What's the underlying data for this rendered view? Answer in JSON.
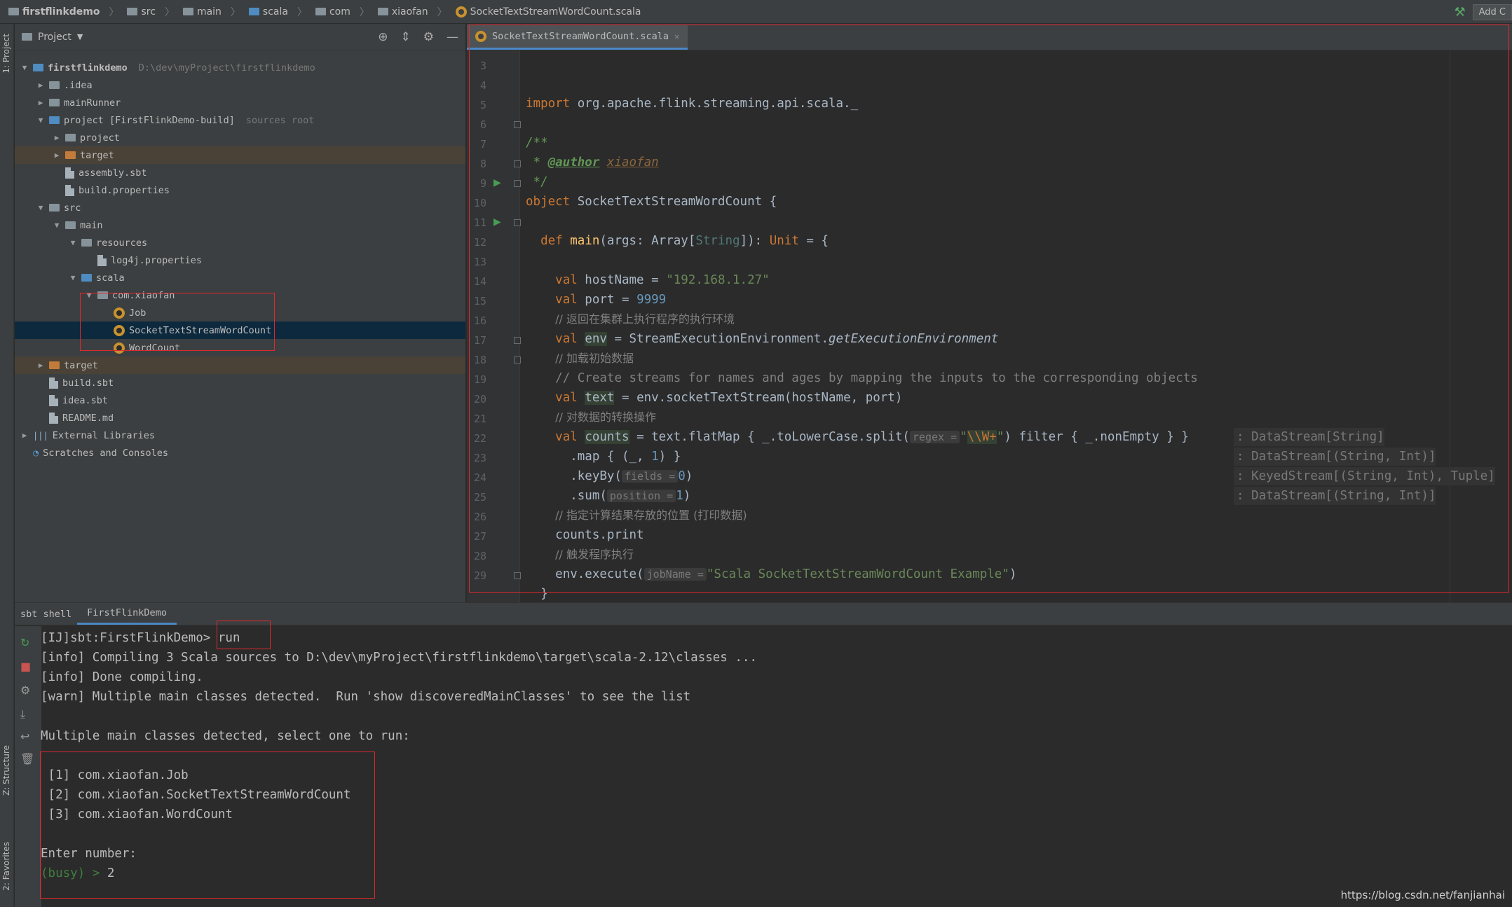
{
  "breadcrumb": [
    "firstflinkdemo",
    "src",
    "main",
    "scala",
    "com",
    "xiaofan",
    "SocketTextStreamWordCount.scala"
  ],
  "nav": {
    "add_label": "Add C"
  },
  "left_stripe": {
    "project_tab": "1: Project",
    "structure_tab": "Z: Structure",
    "favorites_tab": "2: Favorites"
  },
  "project": {
    "header": "Project",
    "tree": [
      {
        "label": "firstflinkdemo",
        "hint": "D:\\dev\\myProject\\firstflinkdemo",
        "arrow": "▼",
        "icon": "module-folder-icon"
      },
      {
        "label": ".idea",
        "hint": "",
        "arrow": "▶",
        "icon": "folder-icon"
      },
      {
        "label": "mainRunner",
        "hint": "",
        "arrow": "▶",
        "icon": "folder-icon"
      },
      {
        "label": "project [FirstFlinkDemo-build]",
        "hint": "sources root",
        "arrow": "▼",
        "icon": "module-folder-icon"
      },
      {
        "label": "project",
        "hint": "",
        "arrow": "▶",
        "icon": "folder-icon"
      },
      {
        "label": "target",
        "hint": "",
        "arrow": "▶",
        "icon": "excluded-folder-icon"
      },
      {
        "label": "assembly.sbt",
        "hint": "",
        "arrow": "",
        "icon": "sbt-file-icon"
      },
      {
        "label": "build.properties",
        "hint": "",
        "arrow": "",
        "icon": "properties-file-icon"
      },
      {
        "label": "src",
        "hint": "",
        "arrow": "▼",
        "icon": "folder-icon"
      },
      {
        "label": "main",
        "hint": "",
        "arrow": "▼",
        "icon": "folder-icon"
      },
      {
        "label": "resources",
        "hint": "",
        "arrow": "▼",
        "icon": "resources-folder-icon"
      },
      {
        "label": "log4j.properties",
        "hint": "",
        "arrow": "",
        "icon": "properties-file-icon"
      },
      {
        "label": "scala",
        "hint": "",
        "arrow": "▼",
        "icon": "source-folder-icon"
      },
      {
        "label": "com.xiaofan",
        "hint": "",
        "arrow": "▼",
        "icon": "package-icon"
      },
      {
        "label": "Job",
        "hint": "",
        "arrow": "",
        "icon": "scala-object-icon"
      },
      {
        "label": "SocketTextStreamWordCount",
        "hint": "",
        "arrow": "",
        "icon": "scala-object-icon"
      },
      {
        "label": "WordCount",
        "hint": "",
        "arrow": "",
        "icon": "scala-object-icon"
      },
      {
        "label": "target",
        "hint": "",
        "arrow": "▶",
        "icon": "excluded-folder-icon"
      },
      {
        "label": "build.sbt",
        "hint": "",
        "arrow": "",
        "icon": "sbt-file-icon"
      },
      {
        "label": "idea.sbt",
        "hint": "",
        "arrow": "",
        "icon": "sbt-file-icon"
      },
      {
        "label": "README.md",
        "hint": "",
        "arrow": "",
        "icon": "markdown-file-icon"
      },
      {
        "label": "External Libraries",
        "hint": "",
        "arrow": "▶",
        "icon": "libraries-icon"
      },
      {
        "label": "Scratches and Consoles",
        "hint": "",
        "arrow": "",
        "icon": "scratches-icon"
      }
    ]
  },
  "editor": {
    "tab": "SocketTextStreamWordCount.scala",
    "line_numbers": [
      "3",
      "4",
      "5",
      "6",
      "7",
      "8",
      "9",
      "10",
      "11",
      "12",
      "13",
      "14",
      "15",
      "16",
      "17",
      "18",
      "19",
      "20",
      "21",
      "22",
      "23",
      "24",
      "25",
      "26",
      "27",
      "28",
      "29"
    ],
    "code": {
      "l4_kw": "import",
      "l4_rest": " org.apache.flink.streaming.api.scala._",
      "l6": "/**",
      "l7_star": " * ",
      "l7_tag": "@author",
      "l7_val": "xiaofan",
      "l8": " */",
      "l9_kw": "object",
      "l9_rest": " SocketTextStreamWordCount {",
      "l11_kw": "def",
      "l11_fn": "main",
      "l11_a": "(args: Array[",
      "l11_t": "String",
      "l11_b": "]): ",
      "l11_u": "Unit",
      "l11_c": " = {",
      "l13_kw": "val",
      "l13_a": " hostName = ",
      "l13_s": "\"192.168.1.27\"",
      "l14_kw": "val",
      "l14_a": " port = ",
      "l14_n": "9999",
      "l15": "// 返回在集群上执行程序的执行环境",
      "l16_kw": "val",
      "l16_v": "env",
      "l16_a": " = StreamExecutionEnvironment.",
      "l16_i": "getExecutionEnvironment",
      "l17": "// 加载初始数据",
      "l18": "// Create streams for names and ages by mapping the inputs to the corresponding objects",
      "l19_kw": "val",
      "l19_v": "text",
      "l19_a": " = env.socketTextStream(hostName, port)",
      "l20": "// 对数据的转换操作",
      "l21_kw": "val",
      "l21_v": "counts",
      "l21_a": " = text.flatMap { _.toLowerCase.split(",
      "l21_h": "regex =",
      "l21_s1": "\"",
      "l21_s2": "\\\\W+",
      "l21_s3": "\"",
      "l21_b": ") filter { _.nonEmpty } }",
      "l22_a": ".map { (_, ",
      "l22_n": "1",
      "l22_b": ") }",
      "l23_a": ".keyBy(",
      "l23_h": "fields =",
      "l23_n": "0",
      "l23_b": ")",
      "l24_a": ".sum(",
      "l24_h": "position =",
      "l24_n": "1",
      "l24_b": ")",
      "l25": "// 指定计算结果存放的位置 (打印数据)",
      "l26": "counts.print",
      "l27": "// 触发程序执行",
      "l28_a": "env.execute(",
      "l28_h": "jobName =",
      "l28_s": "\"Scala SocketTextStreamWordCount Example\"",
      "l28_b": ")",
      "l29": "}"
    },
    "type_hints": [
      ": DataStream[String]",
      ": DataStream[(String, Int)]",
      ": KeyedStream[(String, Int), Tuple]",
      ": DataStream[(String, Int)]"
    ]
  },
  "bottom": {
    "tabs": [
      "sbt shell",
      "FirstFlinkDemo"
    ],
    "prompt": "[IJ]sbt:FirstFlinkDemo> ",
    "command": "run",
    "lines": [
      "[info] Compiling 3 Scala sources to D:\\dev\\myProject\\firstflinkdemo\\target\\scala-2.12\\classes ...",
      "[info] Done compiling.",
      "[warn] Multiple main classes detected.  Run 'show discoveredMainClasses' to see the list",
      "",
      "Multiple main classes detected, select one to run:",
      "",
      " [1] com.xiaofan.Job",
      " [2] com.xiaofan.SocketTextStreamWordCount",
      " [3] com.xiaofan.WordCount",
      "",
      "Enter number:",
      ""
    ],
    "busy": "(busy) > ",
    "answer": "2"
  },
  "watermark": "https://blog.csdn.net/fanjianhai"
}
